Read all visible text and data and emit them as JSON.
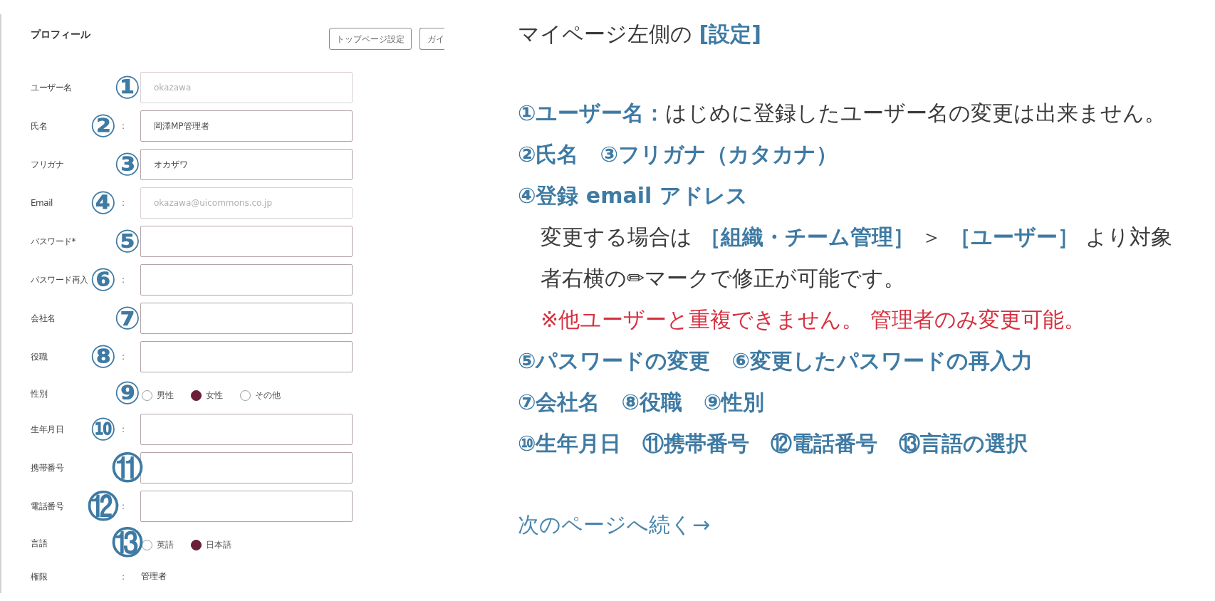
{
  "form": {
    "title": "プロフィール",
    "buttons": [
      {
        "label": "トップページ設定"
      },
      {
        "label": "ガイ"
      }
    ],
    "rows": [
      {
        "kind": "input",
        "label": "ユーザー名",
        "marker": "①",
        "value": "okazawa",
        "disabled": true
      },
      {
        "kind": "input",
        "label": "氏名",
        "separator": ":",
        "marker": "②",
        "value": "岡澤MP管理者",
        "disabled": false
      },
      {
        "kind": "input",
        "label": "フリガナ",
        "marker": "③",
        "value": "オカザワ",
        "disabled": false
      },
      {
        "kind": "input",
        "label": "Email",
        "separator": ":",
        "marker": "④",
        "value": "okazawa@uicommons.co.jp",
        "disabled": true
      },
      {
        "kind": "input",
        "label": "パスワード*",
        "marker": "⑤",
        "disabled": false
      },
      {
        "kind": "input",
        "label": "パスワード再入",
        "separator": ":",
        "marker": "⑥",
        "disabled": false
      },
      {
        "kind": "input",
        "label": "会社名",
        "marker": "⑦",
        "disabled": false
      },
      {
        "kind": "input",
        "label": "役職",
        "separator": ":",
        "marker": "⑧",
        "disabled": false
      },
      {
        "kind": "radio",
        "label": "性別",
        "marker": "⑨",
        "options": [
          {
            "label": "男性",
            "selected": false
          },
          {
            "label": "女性",
            "selected": true
          },
          {
            "label": "その他",
            "selected": false
          }
        ]
      },
      {
        "kind": "input",
        "label": "生年月日",
        "separator": ":",
        "marker": "⑩",
        "disabled": false
      },
      {
        "kind": "input",
        "label": "携帯番号",
        "marker": "⑪",
        "disabled": false
      },
      {
        "kind": "input",
        "label": "電話番号",
        "separator": ":",
        "marker": "⑫",
        "disabled": false
      },
      {
        "kind": "radio",
        "label": "言語",
        "marker": "⑬",
        "options": [
          {
            "label": "英語",
            "selected": false
          },
          {
            "label": "日本語",
            "selected": true
          }
        ]
      },
      {
        "kind": "value",
        "label": "権限",
        "separator": ":",
        "value": "管理者"
      }
    ]
  },
  "guide": {
    "intro": "マイページ左側の **[設定]**",
    "lines": [
      {
        "kind": "item",
        "text": "**①ユーザー名：**はじめに登録したユーザー名の変更は出来ません。"
      },
      {
        "kind": "heading",
        "text": "②氏名　③フリガナ（カタカナ）"
      },
      {
        "kind": "heading",
        "text": "④登録 email アドレス"
      },
      {
        "kind": "detail",
        "text": "変更する場合は **［組織・チーム管理］** ＞ **［ユーザー］** より対象者右横の✏マークで修正が可能です。"
      },
      {
        "kind": "warning",
        "text": "※他ユーザーと重複できません。 管理者のみ変更可能。"
      },
      {
        "kind": "heading",
        "text": "⑤パスワードの変更　⑥変更したパスワードの再入力"
      },
      {
        "kind": "heading",
        "text": "⑦会社名　⑧役職　⑨性別"
      },
      {
        "kind": "heading",
        "text": "⑩生年月日　⑪携帯番号　⑫電話番号　⑬言語の選択"
      }
    ],
    "next_link": "次のページへ続く→"
  }
}
